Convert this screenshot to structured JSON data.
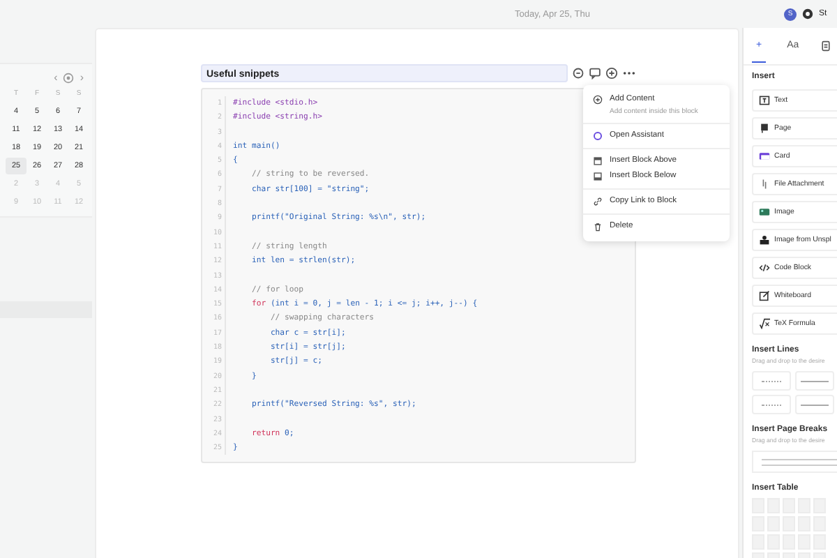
{
  "top_bar": {
    "date": "Today, Apr 25, Thu",
    "avatar_letter": "S",
    "user_label": "St"
  },
  "calendar": {
    "nav": [
      "‹",
      "›"
    ],
    "weekdays": [
      "T",
      "F",
      "S",
      "S"
    ],
    "weeks": [
      [
        {
          "day": "4",
          "muted": false,
          "selected": false
        },
        {
          "day": "5",
          "muted": false,
          "selected": false
        },
        {
          "day": "6",
          "muted": false,
          "selected": false
        },
        {
          "day": "7",
          "muted": false,
          "selected": false
        }
      ],
      [
        {
          "day": "11",
          "muted": false,
          "selected": false
        },
        {
          "day": "12",
          "muted": false,
          "selected": false
        },
        {
          "day": "13",
          "muted": false,
          "selected": false
        },
        {
          "day": "14",
          "muted": false,
          "selected": false
        }
      ],
      [
        {
          "day": "18",
          "muted": false,
          "selected": false
        },
        {
          "day": "19",
          "muted": false,
          "selected": false
        },
        {
          "day": "20",
          "muted": false,
          "selected": false
        },
        {
          "day": "21",
          "muted": false,
          "selected": false
        }
      ],
      [
        {
          "day": "25",
          "muted": false,
          "selected": true
        },
        {
          "day": "26",
          "muted": false,
          "selected": false
        },
        {
          "day": "27",
          "muted": false,
          "selected": false
        },
        {
          "day": "28",
          "muted": false,
          "selected": false
        }
      ],
      [
        {
          "day": "2",
          "muted": true,
          "selected": false
        },
        {
          "day": "3",
          "muted": true,
          "selected": false
        },
        {
          "day": "4",
          "muted": true,
          "selected": false
        },
        {
          "day": "5",
          "muted": true,
          "selected": false
        }
      ],
      [
        {
          "day": "9",
          "muted": true,
          "selected": false
        },
        {
          "day": "10",
          "muted": true,
          "selected": false
        },
        {
          "day": "11",
          "muted": true,
          "selected": false
        },
        {
          "day": "12",
          "muted": true,
          "selected": false
        }
      ]
    ]
  },
  "block": {
    "title": "Useful snippets",
    "lines": [
      {
        "number": "1",
        "tokens": [
          {
            "kind": "preproc",
            "text": "#include <stdio.h>"
          }
        ]
      },
      {
        "number": "2",
        "tokens": [
          {
            "kind": "preproc",
            "text": "#include <string.h>"
          }
        ]
      },
      {
        "number": "3"
      },
      {
        "number": "4",
        "tokens": [
          {
            "kind": "type",
            "text": "int"
          },
          {
            "kind": "code",
            "text": " main()"
          }
        ]
      },
      {
        "number": "5",
        "tokens": [
          {
            "kind": "code",
            "text": "{"
          }
        ]
      },
      {
        "number": "6",
        "tokens": [
          {
            "kind": "comment",
            "text": "    // string to be reversed."
          }
        ]
      },
      {
        "number": "7",
        "tokens": [
          {
            "kind": "code",
            "text": "    char str[100] = \"string\";"
          }
        ]
      },
      {
        "number": "8"
      },
      {
        "number": "9",
        "tokens": [
          {
            "kind": "code",
            "text": "    printf(\"Original String: %s\\n\", str);"
          }
        ]
      },
      {
        "number": "10"
      },
      {
        "number": "11",
        "tokens": [
          {
            "kind": "comment",
            "text": "    // string length"
          }
        ]
      },
      {
        "number": "12",
        "tokens": [
          {
            "kind": "code",
            "text": "    int len = strlen(str);"
          }
        ]
      },
      {
        "number": "13"
      },
      {
        "number": "14",
        "tokens": [
          {
            "kind": "comment",
            "text": "    // for loop"
          }
        ]
      },
      {
        "number": "15",
        "tokens": [
          {
            "kind": "control",
            "text": "    for"
          },
          {
            "kind": "code",
            "text": " (int i = 0, j = len - 1; i <= j; i++, j--) {"
          }
        ]
      },
      {
        "number": "16",
        "tokens": [
          {
            "kind": "comment",
            "text": "        // swapping characters"
          }
        ]
      },
      {
        "number": "17",
        "tokens": [
          {
            "kind": "code",
            "text": "        char c = str[i];"
          }
        ]
      },
      {
        "number": "18",
        "tokens": [
          {
            "kind": "code",
            "text": "        str[i] = str[j];"
          }
        ]
      },
      {
        "number": "19",
        "tokens": [
          {
            "kind": "code",
            "text": "        str[j] = c;"
          }
        ]
      },
      {
        "number": "20",
        "tokens": [
          {
            "kind": "code",
            "text": "    }"
          }
        ]
      },
      {
        "number": "21"
      },
      {
        "number": "22",
        "tokens": [
          {
            "kind": "code",
            "text": "    printf(\"Reversed String: %s\", str);"
          }
        ]
      },
      {
        "number": "23"
      },
      {
        "number": "24",
        "tokens": [
          {
            "kind": "control",
            "text": "    return"
          },
          {
            "kind": "code",
            "text": " 0;"
          }
        ]
      },
      {
        "number": "25",
        "tokens": [
          {
            "kind": "code",
            "text": "}"
          }
        ]
      }
    ]
  },
  "block_menu": {
    "groups": [
      [
        {
          "label": "Add Content",
          "description": "Add content inside this block"
        }
      ],
      [
        {
          "label": "Open Assistant"
        }
      ],
      [
        {
          "label": "Insert Block Above"
        },
        {
          "label": "Insert Block Below"
        }
      ],
      [
        {
          "label": "Copy Link to Block"
        }
      ],
      [
        {
          "label": "Delete"
        }
      ]
    ]
  },
  "right_panel": {
    "tabs": [
      {
        "label": "+",
        "selected": true
      },
      {
        "label": "Aa",
        "selected": false
      }
    ],
    "insert_title": "Insert",
    "insert_items": [
      "Text",
      "Page",
      "Card",
      "File Attachment",
      "Image",
      "Image from Unspl",
      "Code Block",
      "Whiteboard",
      "TeX Formula"
    ],
    "lines_title": "Insert Lines",
    "lines_hint": "Drag and drop to the desire",
    "page_breaks_title": "Insert Page Breaks",
    "page_breaks_hint": "Drag and drop to the desire",
    "table_title": "Insert Table"
  }
}
